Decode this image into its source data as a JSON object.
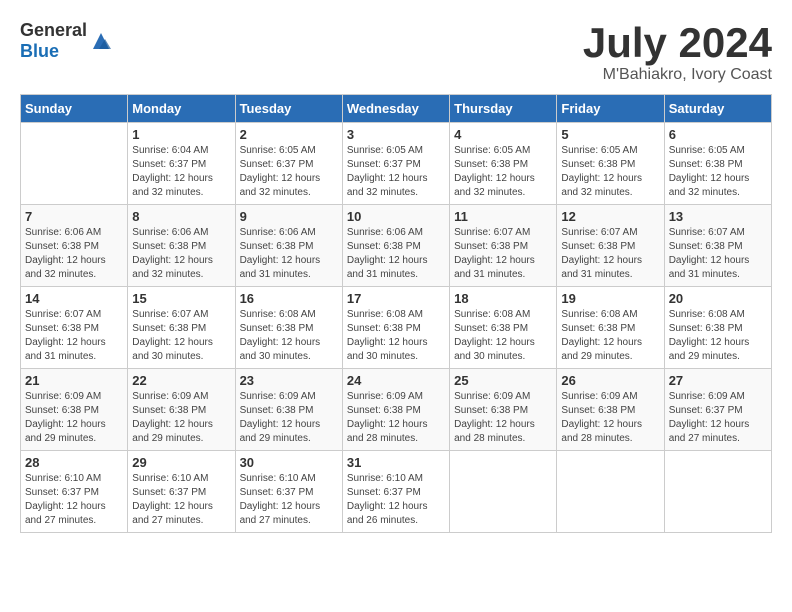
{
  "header": {
    "logo_general": "General",
    "logo_blue": "Blue",
    "title": "July 2024",
    "subtitle": "M'Bahiakro, Ivory Coast"
  },
  "calendar": {
    "days_of_week": [
      "Sunday",
      "Monday",
      "Tuesday",
      "Wednesday",
      "Thursday",
      "Friday",
      "Saturday"
    ],
    "weeks": [
      [
        {
          "day": "",
          "info": ""
        },
        {
          "day": "1",
          "info": "Sunrise: 6:04 AM\nSunset: 6:37 PM\nDaylight: 12 hours\nand 32 minutes."
        },
        {
          "day": "2",
          "info": "Sunrise: 6:05 AM\nSunset: 6:37 PM\nDaylight: 12 hours\nand 32 minutes."
        },
        {
          "day": "3",
          "info": "Sunrise: 6:05 AM\nSunset: 6:37 PM\nDaylight: 12 hours\nand 32 minutes."
        },
        {
          "day": "4",
          "info": "Sunrise: 6:05 AM\nSunset: 6:38 PM\nDaylight: 12 hours\nand 32 minutes."
        },
        {
          "day": "5",
          "info": "Sunrise: 6:05 AM\nSunset: 6:38 PM\nDaylight: 12 hours\nand 32 minutes."
        },
        {
          "day": "6",
          "info": "Sunrise: 6:05 AM\nSunset: 6:38 PM\nDaylight: 12 hours\nand 32 minutes."
        }
      ],
      [
        {
          "day": "7",
          "info": "Sunrise: 6:06 AM\nSunset: 6:38 PM\nDaylight: 12 hours\nand 32 minutes."
        },
        {
          "day": "8",
          "info": "Sunrise: 6:06 AM\nSunset: 6:38 PM\nDaylight: 12 hours\nand 32 minutes."
        },
        {
          "day": "9",
          "info": "Sunrise: 6:06 AM\nSunset: 6:38 PM\nDaylight: 12 hours\nand 31 minutes."
        },
        {
          "day": "10",
          "info": "Sunrise: 6:06 AM\nSunset: 6:38 PM\nDaylight: 12 hours\nand 31 minutes."
        },
        {
          "day": "11",
          "info": "Sunrise: 6:07 AM\nSunset: 6:38 PM\nDaylight: 12 hours\nand 31 minutes."
        },
        {
          "day": "12",
          "info": "Sunrise: 6:07 AM\nSunset: 6:38 PM\nDaylight: 12 hours\nand 31 minutes."
        },
        {
          "day": "13",
          "info": "Sunrise: 6:07 AM\nSunset: 6:38 PM\nDaylight: 12 hours\nand 31 minutes."
        }
      ],
      [
        {
          "day": "14",
          "info": "Sunrise: 6:07 AM\nSunset: 6:38 PM\nDaylight: 12 hours\nand 31 minutes."
        },
        {
          "day": "15",
          "info": "Sunrise: 6:07 AM\nSunset: 6:38 PM\nDaylight: 12 hours\nand 30 minutes."
        },
        {
          "day": "16",
          "info": "Sunrise: 6:08 AM\nSunset: 6:38 PM\nDaylight: 12 hours\nand 30 minutes."
        },
        {
          "day": "17",
          "info": "Sunrise: 6:08 AM\nSunset: 6:38 PM\nDaylight: 12 hours\nand 30 minutes."
        },
        {
          "day": "18",
          "info": "Sunrise: 6:08 AM\nSunset: 6:38 PM\nDaylight: 12 hours\nand 30 minutes."
        },
        {
          "day": "19",
          "info": "Sunrise: 6:08 AM\nSunset: 6:38 PM\nDaylight: 12 hours\nand 29 minutes."
        },
        {
          "day": "20",
          "info": "Sunrise: 6:08 AM\nSunset: 6:38 PM\nDaylight: 12 hours\nand 29 minutes."
        }
      ],
      [
        {
          "day": "21",
          "info": "Sunrise: 6:09 AM\nSunset: 6:38 PM\nDaylight: 12 hours\nand 29 minutes."
        },
        {
          "day": "22",
          "info": "Sunrise: 6:09 AM\nSunset: 6:38 PM\nDaylight: 12 hours\nand 29 minutes."
        },
        {
          "day": "23",
          "info": "Sunrise: 6:09 AM\nSunset: 6:38 PM\nDaylight: 12 hours\nand 29 minutes."
        },
        {
          "day": "24",
          "info": "Sunrise: 6:09 AM\nSunset: 6:38 PM\nDaylight: 12 hours\nand 28 minutes."
        },
        {
          "day": "25",
          "info": "Sunrise: 6:09 AM\nSunset: 6:38 PM\nDaylight: 12 hours\nand 28 minutes."
        },
        {
          "day": "26",
          "info": "Sunrise: 6:09 AM\nSunset: 6:38 PM\nDaylight: 12 hours\nand 28 minutes."
        },
        {
          "day": "27",
          "info": "Sunrise: 6:09 AM\nSunset: 6:37 PM\nDaylight: 12 hours\nand 27 minutes."
        }
      ],
      [
        {
          "day": "28",
          "info": "Sunrise: 6:10 AM\nSunset: 6:37 PM\nDaylight: 12 hours\nand 27 minutes."
        },
        {
          "day": "29",
          "info": "Sunrise: 6:10 AM\nSunset: 6:37 PM\nDaylight: 12 hours\nand 27 minutes."
        },
        {
          "day": "30",
          "info": "Sunrise: 6:10 AM\nSunset: 6:37 PM\nDaylight: 12 hours\nand 27 minutes."
        },
        {
          "day": "31",
          "info": "Sunrise: 6:10 AM\nSunset: 6:37 PM\nDaylight: 12 hours\nand 26 minutes."
        },
        {
          "day": "",
          "info": ""
        },
        {
          "day": "",
          "info": ""
        },
        {
          "day": "",
          "info": ""
        }
      ]
    ]
  }
}
